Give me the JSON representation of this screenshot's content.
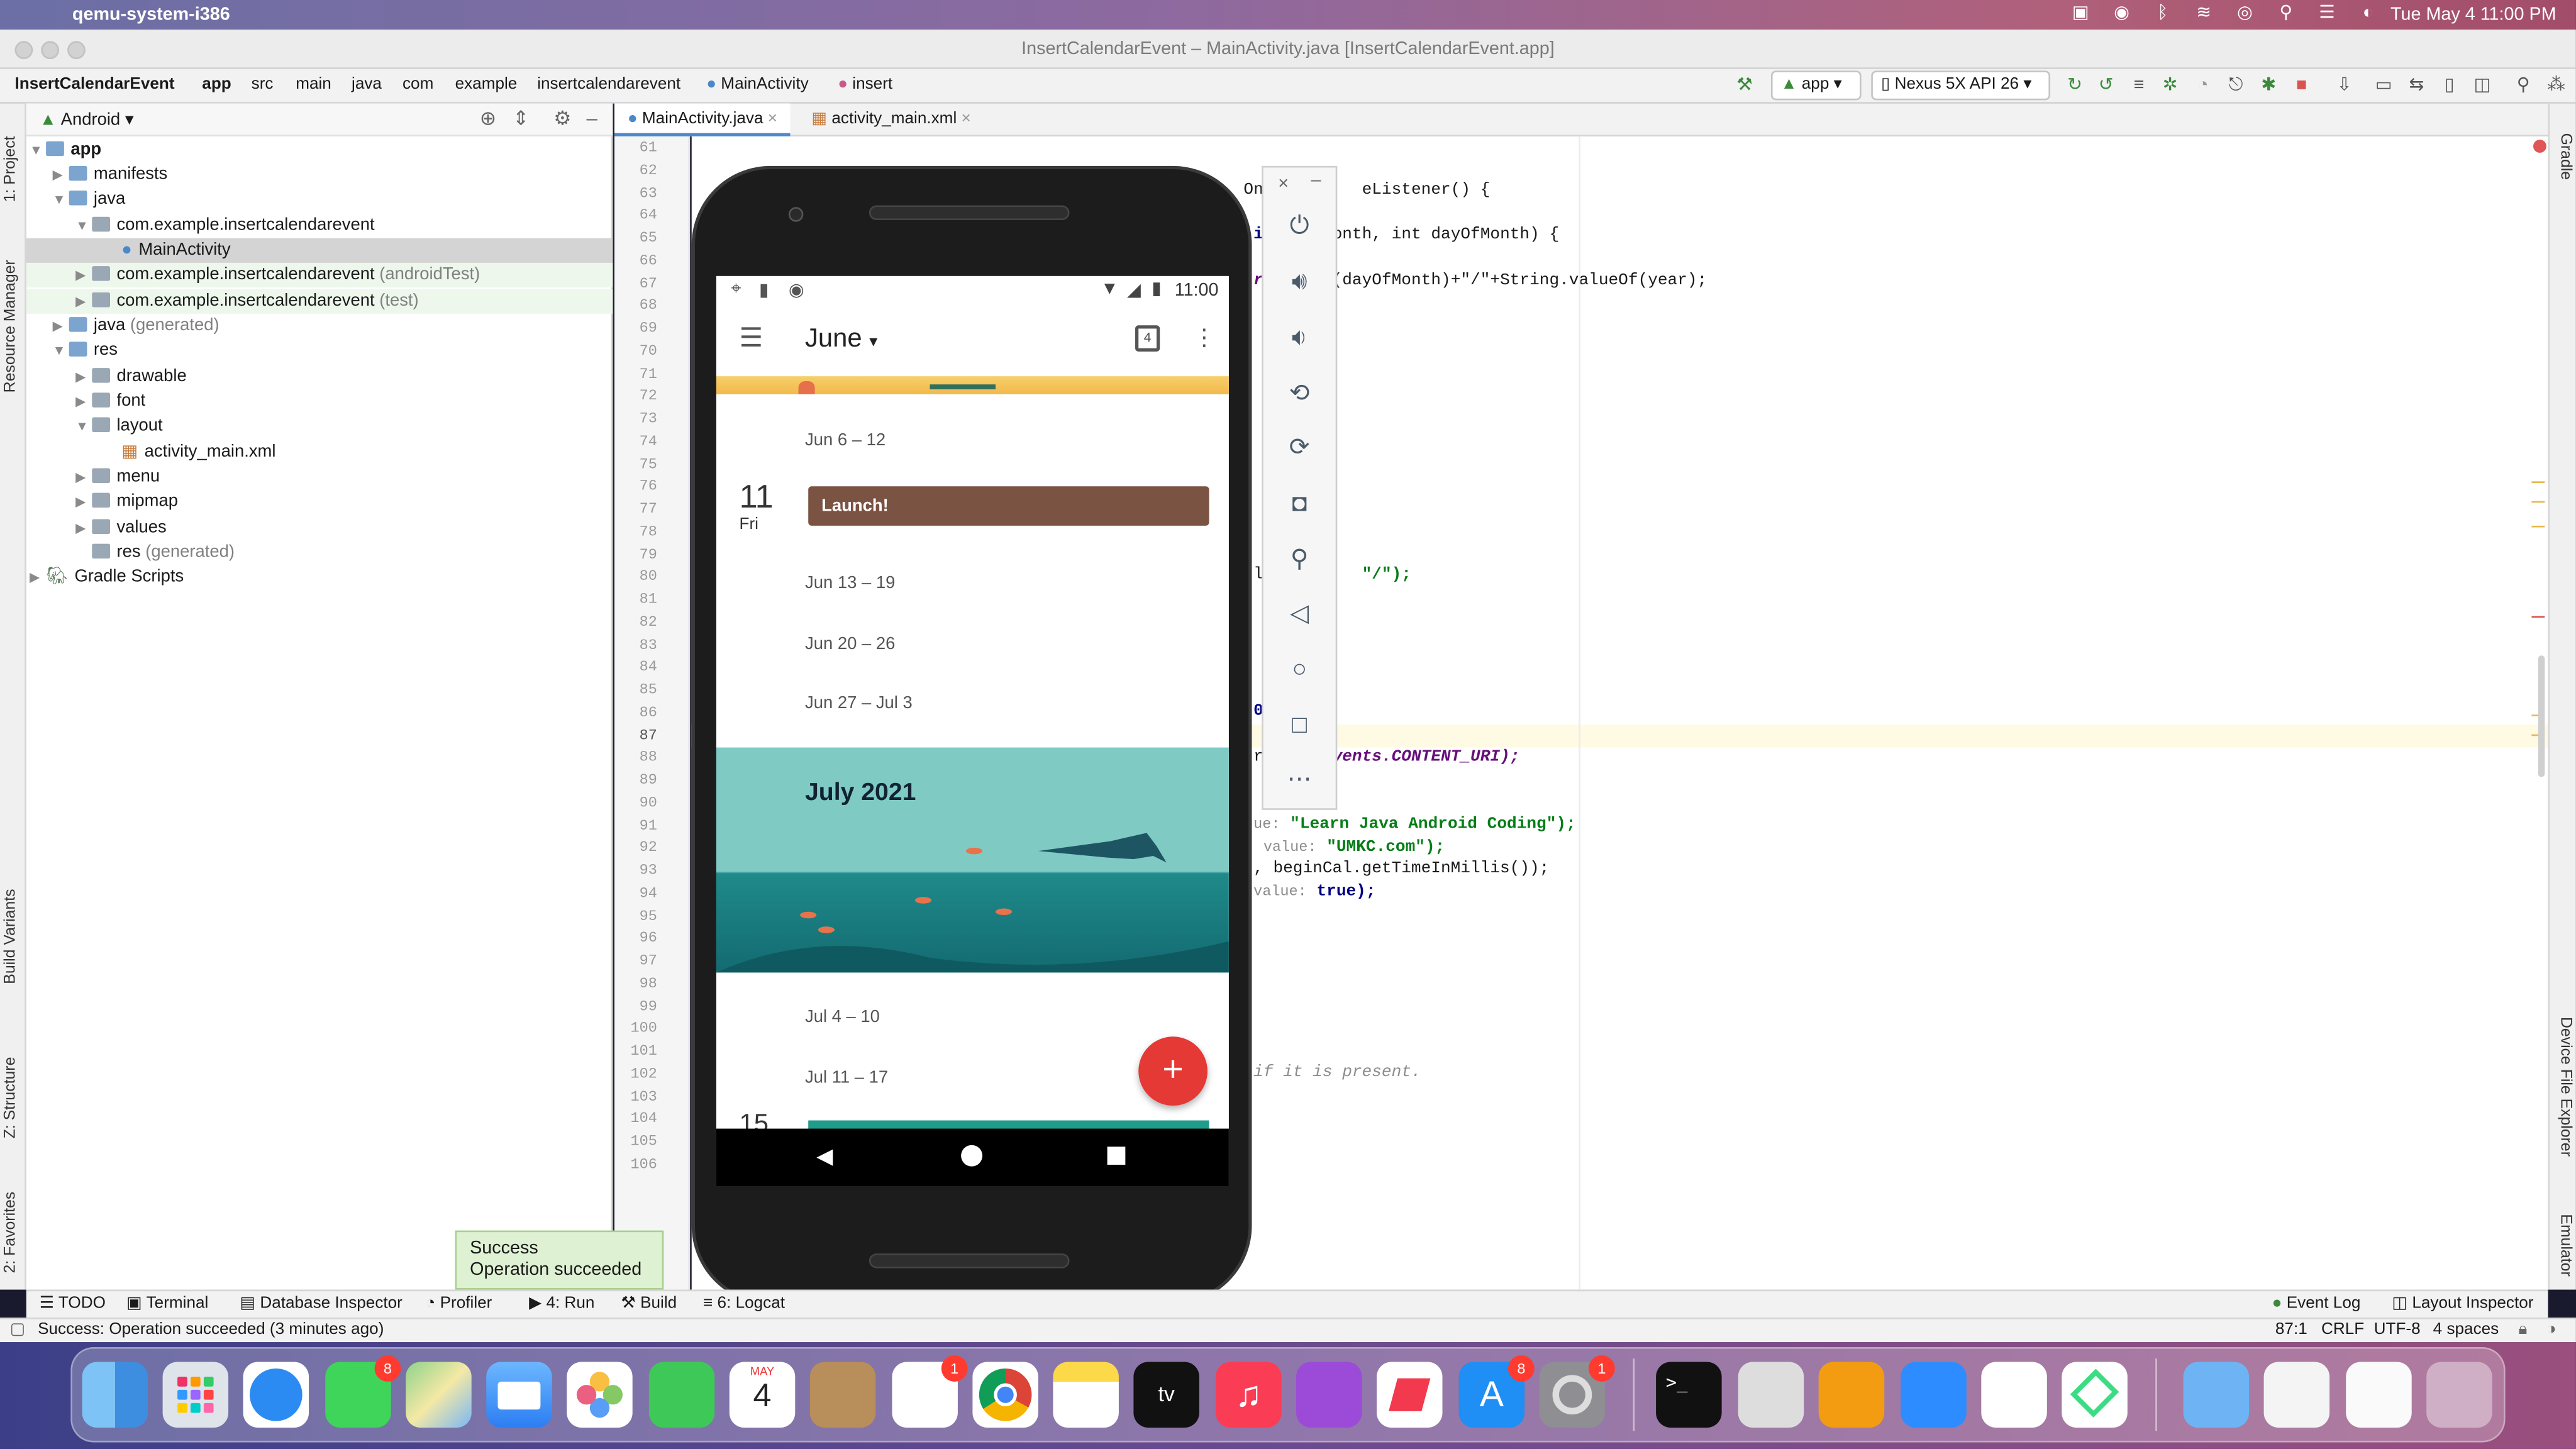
{
  "menubar": {
    "app": "qemu-system-i386",
    "datetime": "Tue May 4  11:00 PM"
  },
  "window": {
    "title": "InsertCalendarEvent – MainActivity.java [InsertCalendarEvent.app]"
  },
  "breadcrumb": [
    "InsertCalendarEvent",
    "app",
    "src",
    "main",
    "java",
    "com",
    "example",
    "insertcalendarevent",
    "MainActivity",
    "insert"
  ],
  "toolbar": {
    "config": "app",
    "device": "Nexus 5X API 26"
  },
  "left_strip": {
    "project": "1: Project",
    "resource_manager": "Resource Manager",
    "build_variants": "Build Variants",
    "structure": "Z: Structure",
    "favorites": "2: Favorites"
  },
  "right_strip": {
    "gradle": "Gradle",
    "device_file_explorer": "Device File Explorer",
    "emulator": "Emulator"
  },
  "project": {
    "view": "Android",
    "tree": [
      {
        "label": "app",
        "suffix": ""
      },
      {
        "label": "manifests",
        "suffix": ""
      },
      {
        "label": "java",
        "suffix": ""
      },
      {
        "label": "com.example.insertcalendarevent",
        "suffix": ""
      },
      {
        "label": "MainActivity",
        "suffix": ""
      },
      {
        "label": "com.example.insertcalendarevent",
        "suffix": "(androidTest)"
      },
      {
        "label": "com.example.insertcalendarevent",
        "suffix": "(test)"
      },
      {
        "label": "java",
        "suffix": "(generated)"
      },
      {
        "label": "res",
        "suffix": ""
      },
      {
        "label": "drawable",
        "suffix": ""
      },
      {
        "label": "font",
        "suffix": ""
      },
      {
        "label": "layout",
        "suffix": ""
      },
      {
        "label": "activity_main.xml",
        "suffix": ""
      },
      {
        "label": "menu",
        "suffix": ""
      },
      {
        "label": "mipmap",
        "suffix": ""
      },
      {
        "label": "values",
        "suffix": ""
      },
      {
        "label": "res",
        "suffix": "(generated)"
      },
      {
        "label": "Gradle Scripts",
        "suffix": ""
      }
    ]
  },
  "tabs": [
    "MainActivity.java",
    "activity_main.xml"
  ],
  "line_numbers": [
    "61",
    "62",
    "63",
    "64",
    "65",
    "66",
    "67",
    "68",
    "69",
    "70",
    "71",
    "72",
    "73",
    "74",
    "75",
    "76",
    "77",
    "78",
    "79",
    "80",
    "81",
    "82",
    "83",
    "84",
    "85",
    "86",
    "87",
    "88",
    "89",
    "90",
    "91",
    "92",
    "93",
    "94",
    "95",
    "96",
    "97",
    "98",
    "99",
    "100",
    "101",
    "102",
    "103",
    "104",
    "105",
    "106"
  ],
  "code": {
    "l63_a": "On",
    "l63_b": "eListener() {",
    "l65": "int month, int dayOfMonth) {",
    "l67": "Of(dayOfMonth)+\"/\"+String.valueOf(year);",
    "l80": "\"/\");",
    "l86": "0",
    "l88": "Events.CONTENT_URI);",
    "l91_hint": "ue:",
    "l91": "\"Learn Java Android Coding\");",
    "l92_hint": "value:",
    "l92": "\"UMKC.com\");",
    "l93": ", beginCal.getTimeInMillis());",
    "l94_hint": "value:",
    "l94": "true);",
    "l102": "if it is present."
  },
  "phone": {
    "time": "11:00",
    "month": "June",
    "today": "4",
    "weeks": [
      "Jun 6 – 12",
      "Jun 13 – 19",
      "Jun 20 – 26",
      "Jun 27 – Jul 3",
      "Jul 4 – 10",
      "Jul 11 – 17"
    ],
    "event_day": "11",
    "event_weekday": "Fri",
    "event_title": "Launch!",
    "month_banner": "July 2021",
    "next_day": "15"
  },
  "bottom_tools": [
    "TODO",
    "Terminal",
    "Database Inspector",
    "Profiler",
    "4: Run",
    "Build",
    "6: Logcat",
    "Event Log",
    "Layout Inspector"
  ],
  "toast": {
    "title": "Success",
    "message": "Operation succeeded"
  },
  "status": {
    "message": "Success: Operation succeeded (3 minutes ago)",
    "position": "87:1",
    "line_sep": "CRLF",
    "encoding": "UTF-8",
    "indent": "4 spaces"
  },
  "dock": {
    "calendar_month": "MAY",
    "calendar_day": "4",
    "badges": {
      "messages": "8",
      "reminders": "1",
      "appstore": "8",
      "settings": "1"
    }
  }
}
